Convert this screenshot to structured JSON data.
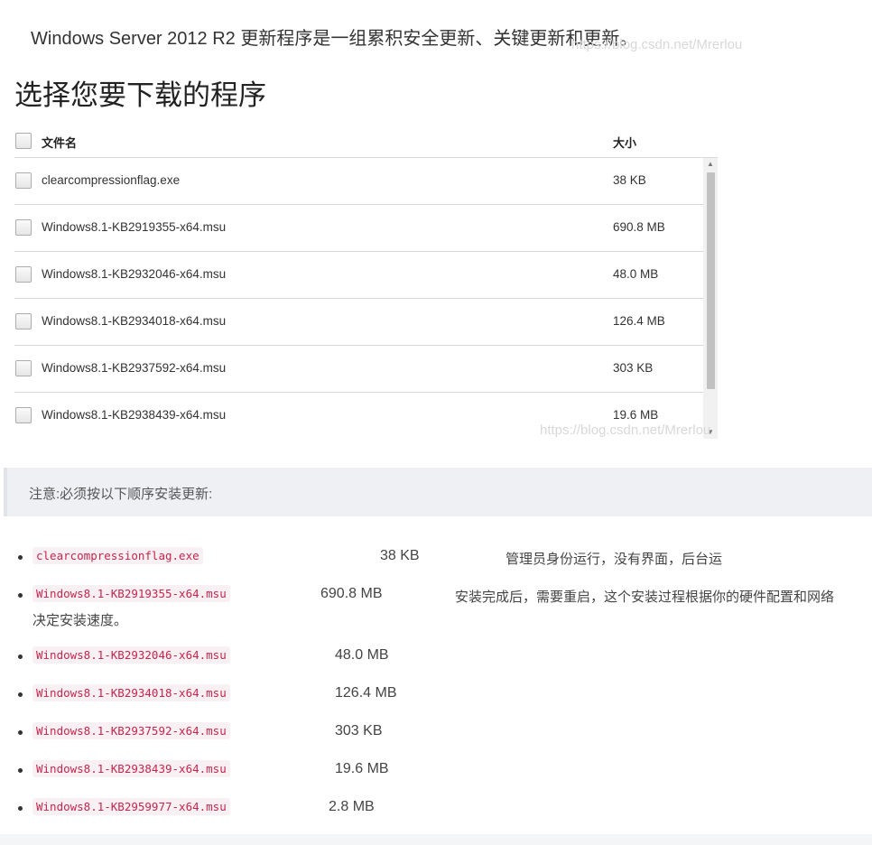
{
  "intro_text": "Windows Server 2012 R2 更新程序是一组累积安全更新、关键更新和更新。",
  "watermark": "https://blog.csdn.net/Mrerlou",
  "heading": "选择您要下载的程序",
  "table": {
    "col_name": "文件名",
    "col_size": "大小",
    "rows": [
      {
        "name": "clearcompressionflag.exe",
        "size": "38 KB"
      },
      {
        "name": "Windows8.1-KB2919355-x64.msu",
        "size": "690.8 MB"
      },
      {
        "name": "Windows8.1-KB2932046-x64.msu",
        "size": "48.0 MB"
      },
      {
        "name": "Windows8.1-KB2934018-x64.msu",
        "size": "126.4 MB"
      },
      {
        "name": "Windows8.1-KB2937592-x64.msu",
        "size": "303 KB"
      },
      {
        "name": "Windows8.1-KB2938439-x64.msu",
        "size": "19.6 MB"
      }
    ]
  },
  "note": "注意:必须按以下顺序安装更新:",
  "install_list": [
    {
      "file": "clearcompressionflag.exe",
      "size": "38 KB",
      "note": "管理员身份运行，没有界面，后台运"
    },
    {
      "file": "Windows8.1-KB2919355-x64.msu",
      "size": "690.8 MB",
      "note": "安装完成后，需要重启，这个安装过程根据你的硬件配置和网络",
      "note_cont": "决定安装速度。"
    },
    {
      "file": "Windows8.1-KB2932046-x64.msu",
      "size": "48.0 MB"
    },
    {
      "file": "Windows8.1-KB2934018-x64.msu",
      "size": "126.4 MB"
    },
    {
      "file": "Windows8.1-KB2937592-x64.msu",
      "size": "303 KB"
    },
    {
      "file": "Windows8.1-KB2938439-x64.msu",
      "size": "19.6 MB"
    },
    {
      "file": "Windows8.1-KB2959977-x64.msu",
      "size": "2.8 MB"
    }
  ]
}
